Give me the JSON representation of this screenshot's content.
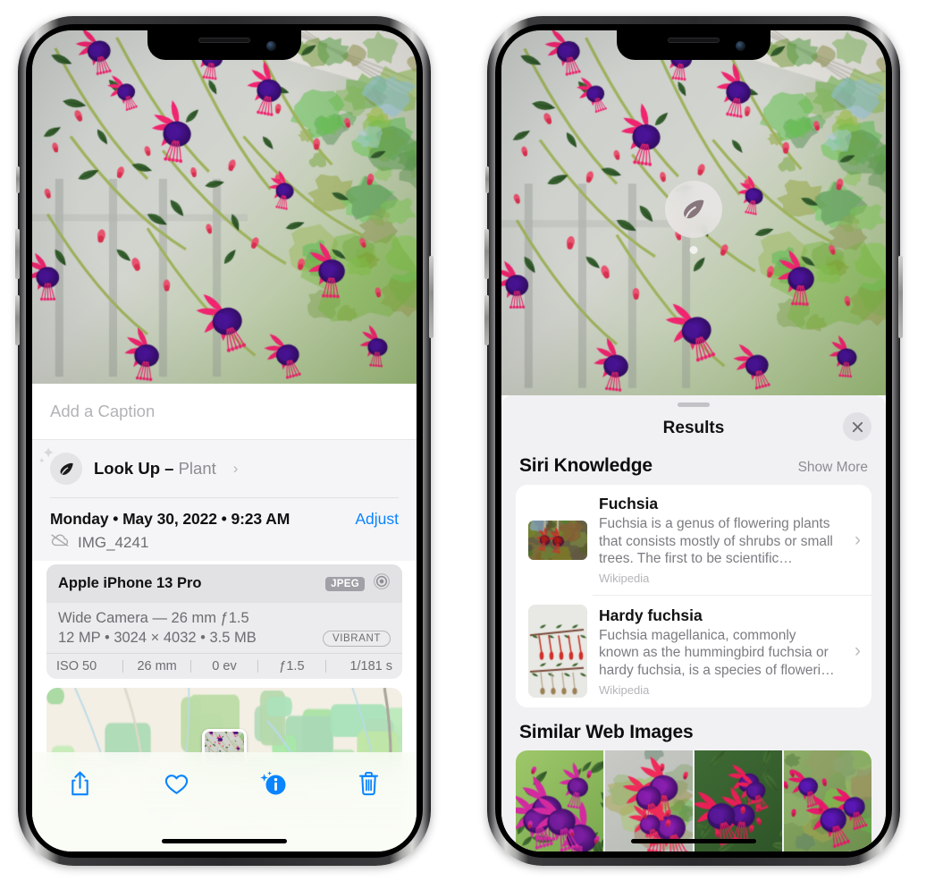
{
  "left_phone": {
    "name": "photos-detail-view",
    "caption": {
      "placeholder": "Add a Caption",
      "value": ""
    },
    "look_up": {
      "icon": "leaf-icon",
      "label": "Look Up",
      "dash": " – ",
      "subject": "Plant",
      "chevron": "›"
    },
    "info": {
      "date": "Monday • May 30, 2022 • 9:23 AM",
      "adjust_label": "Adjust",
      "cloud_icon": "icloud-slash-icon",
      "filename": "IMG_4241"
    },
    "camera_card": {
      "model": "Apple iPhone 13 Pro",
      "format_badge": "JPEG",
      "lens_icon": "camera-lens-icon",
      "lens_line": "Wide Camera — 26 mm ƒ1.5",
      "specs_line": "12 MP • 3024 × 4032 • 3.5 MB",
      "style_badge": "VIBRANT",
      "exif": [
        "ISO 50",
        "26 mm",
        "0 ev",
        "ƒ1.5",
        "1/181 s"
      ]
    },
    "map": {
      "name": "location-map",
      "pin": "photo-pin"
    },
    "toolbar": [
      {
        "name": "share-button",
        "icon": "share-icon"
      },
      {
        "name": "favorite-button",
        "icon": "heart-icon"
      },
      {
        "name": "info-button",
        "icon": "info-sparkle-icon"
      },
      {
        "name": "delete-button",
        "icon": "trash-icon"
      }
    ],
    "accent": "#0a84ff"
  },
  "right_phone": {
    "name": "visual-look-up-results",
    "badge": {
      "icon": "leaf-icon",
      "name": "visual-look-up-badge"
    },
    "sheet": {
      "title": "Results",
      "close_icon": "close-icon",
      "sections": [
        {
          "title": "Siri Knowledge",
          "action": "Show More",
          "items": [
            {
              "title": "Fuchsia",
              "desc": "Fuchsia is a genus of flowering plants that consists mostly of shrubs or small trees. The first to be scientific…",
              "source": "Wikipedia",
              "thumb": "fuchsia-red-thumb",
              "chevron": "›"
            },
            {
              "title": "Hardy fuchsia",
              "desc": "Fuchsia magellanica, commonly known as the hummingbird fuchsia or hardy fuchsia, is a species of floweri…",
              "source": "Wikipedia",
              "thumb": "hardy-fuchsia-specimen-thumb",
              "chevron": "›"
            }
          ]
        },
        {
          "title": "Similar Web Images",
          "images": [
            "web-image-1",
            "web-image-2",
            "web-image-3",
            "web-image-4"
          ]
        }
      ]
    }
  }
}
